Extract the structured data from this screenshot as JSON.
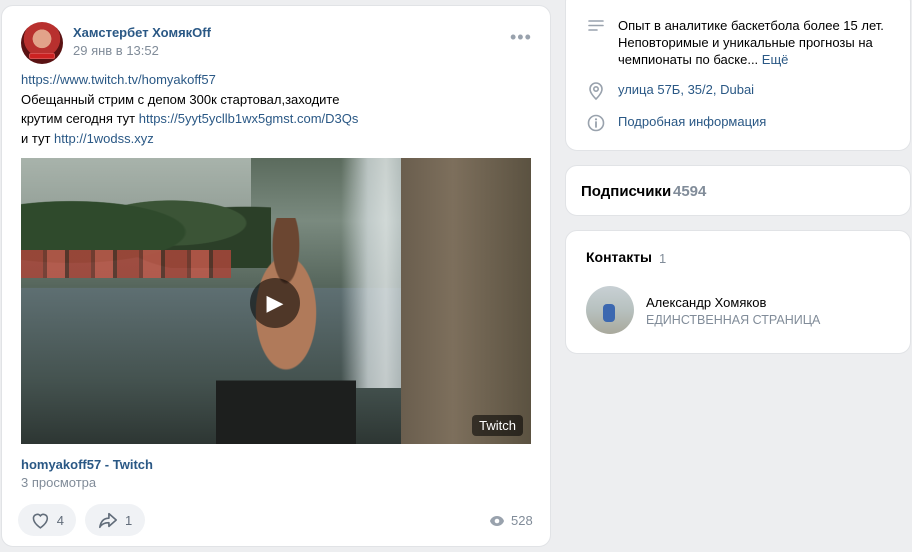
{
  "post": {
    "author": "Хамстербет ХомякOff",
    "date": "29 янв в 13:52",
    "more_label": "•••",
    "text": {
      "link1": "https://www.twitch.tv/homyakoff57",
      "line2": "Обещанный стрим с депом 300к стартовал,заходите",
      "line3_prefix": "крутим сегодня тут ",
      "link2": "https://5yyt5ycllb1wx5gmst.com/D3Qs",
      "line4_prefix": "и тут ",
      "link3": "http://1wodss.xyz"
    },
    "video": {
      "badge": "Twitch",
      "title": "homyakoff57 - Twitch",
      "views": "3 просмотра"
    },
    "actions": {
      "likes": "4",
      "shares": "1",
      "views": "528"
    }
  },
  "sidebar": {
    "info": {
      "description": "Опыт в аналитике баскетбола более 15 лет. Неповторимые и уникальные прогнозы на чемпионаты по баске...",
      "more_link": "Ещё",
      "address": "улица 57Б, 35/2, Dubai",
      "details_link": "Подробная информация"
    },
    "subscribers": {
      "label": "Подписчики",
      "count": "4594"
    },
    "contacts": {
      "label": "Контакты",
      "count": "1",
      "items": [
        {
          "name": "Александр Хомяков",
          "role": "ЕДИНСТВЕННАЯ СТРАНИЦА"
        }
      ]
    }
  },
  "colors": {
    "background": "#edeef0",
    "link": "#2a5885",
    "muted": "#818c99",
    "pill": "#f0f2f5"
  }
}
